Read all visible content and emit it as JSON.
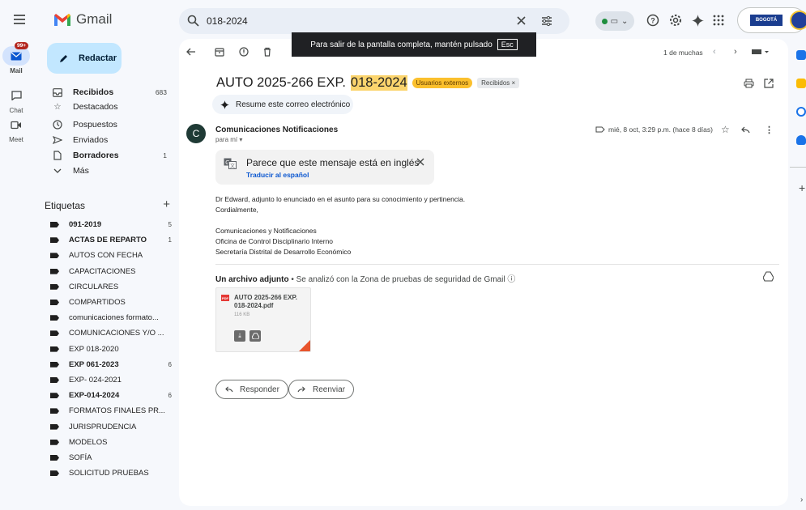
{
  "app": {
    "logo_text": "Gmail"
  },
  "search": {
    "value": "018-2024"
  },
  "account": {
    "badge_text": "BOGOTÁ"
  },
  "rail": [
    {
      "label": "Mail",
      "icon": "mail-icon",
      "badge": "99+"
    },
    {
      "label": "Chat",
      "icon": "chat-icon"
    },
    {
      "label": "Meet",
      "icon": "video-icon"
    }
  ],
  "compose": {
    "label": "Redactar"
  },
  "nav": [
    {
      "label": "Recibidos",
      "icon": "inbox-icon",
      "count": "683",
      "bold": true
    },
    {
      "label": "Destacados",
      "icon": "star-icon",
      "count": "",
      "bold": false
    },
    {
      "label": "Pospuestos",
      "icon": "clock-icon",
      "count": "",
      "bold": false
    },
    {
      "label": "Enviados",
      "icon": "send-icon",
      "count": "",
      "bold": false
    },
    {
      "label": "Borradores",
      "icon": "draft-icon",
      "count": "1",
      "bold": true
    },
    {
      "label": "Más",
      "icon": "chevron-down-icon",
      "count": "",
      "bold": false
    }
  ],
  "labels_header": {
    "title": "Etiquetas",
    "add": "+"
  },
  "labels": [
    {
      "name": "091-2019",
      "count": "5",
      "bold": true
    },
    {
      "name": "ACTAS DE REPARTO",
      "count": "1",
      "bold": true
    },
    {
      "name": "AUTOS CON FECHA",
      "count": "",
      "bold": false
    },
    {
      "name": "CAPACITACIONES",
      "count": "",
      "bold": false
    },
    {
      "name": "CIRCULARES",
      "count": "",
      "bold": false
    },
    {
      "name": "COMPARTIDOS",
      "count": "",
      "bold": false
    },
    {
      "name": "comunicaciones formato...",
      "count": "",
      "bold": false
    },
    {
      "name": "COMUNICACIONES Y/O ...",
      "count": "",
      "bold": false
    },
    {
      "name": "EXP 018-2020",
      "count": "",
      "bold": false
    },
    {
      "name": "EXP 061-2023",
      "count": "6",
      "bold": true
    },
    {
      "name": "EXP- 024-2021",
      "count": "",
      "bold": false
    },
    {
      "name": "EXP-014-2024",
      "count": "6",
      "bold": true
    },
    {
      "name": "FORMATOS FINALES PR...",
      "count": "",
      "bold": false
    },
    {
      "name": "JURISPRUDENCIA",
      "count": "",
      "bold": false
    },
    {
      "name": "MODELOS",
      "count": "",
      "bold": false
    },
    {
      "name": "SOFÍA",
      "count": "",
      "bold": false
    },
    {
      "name": "SOLICITUD PRUEBAS",
      "count": "",
      "bold": false
    }
  ],
  "toast": {
    "text": "Para salir de la pantalla completa, mantén pulsado",
    "key": "Esc"
  },
  "toolbar": {
    "pagination": "1 de muchas"
  },
  "email": {
    "subject_prefix": "AUTO 2025-266 EXP.",
    "subject_highlight": "018-2024",
    "chip_external": "Usuarios externos",
    "chip_inbox": "Recibidos ×",
    "summarize": "Resume este correo electrónico",
    "sender_initial": "C",
    "sender": "Comunicaciones Notificaciones",
    "to": "para mí ▾",
    "date": "mié, 8 oct, 3:29 p.m. (hace 8 días)",
    "translate_title": "Parece que este mensaje está en inglés",
    "translate_link": "Traducir al español",
    "body": [
      "Dr Edward, adjunto lo enunciado en el asunto para su conocimiento y pertinencia.",
      "Cordialmente,",
      "Comunicaciones y Notificaciones",
      "Oficina de Control Disciplinario Interno",
      "Secretaría Distrital de Desarrollo Económico"
    ],
    "attachment_summary_bold": "Un archivo adjunto",
    "attachment_summary_rest": " • Se analizó con la Zona de pruebas de seguridad de Gmail ⓘ",
    "attachment": {
      "badge": "PDF",
      "name": "AUTO 2025-266 EXP. 018-2024.pdf",
      "size": "116 KB"
    },
    "reply": "Responder",
    "forward": "Reenviar"
  }
}
